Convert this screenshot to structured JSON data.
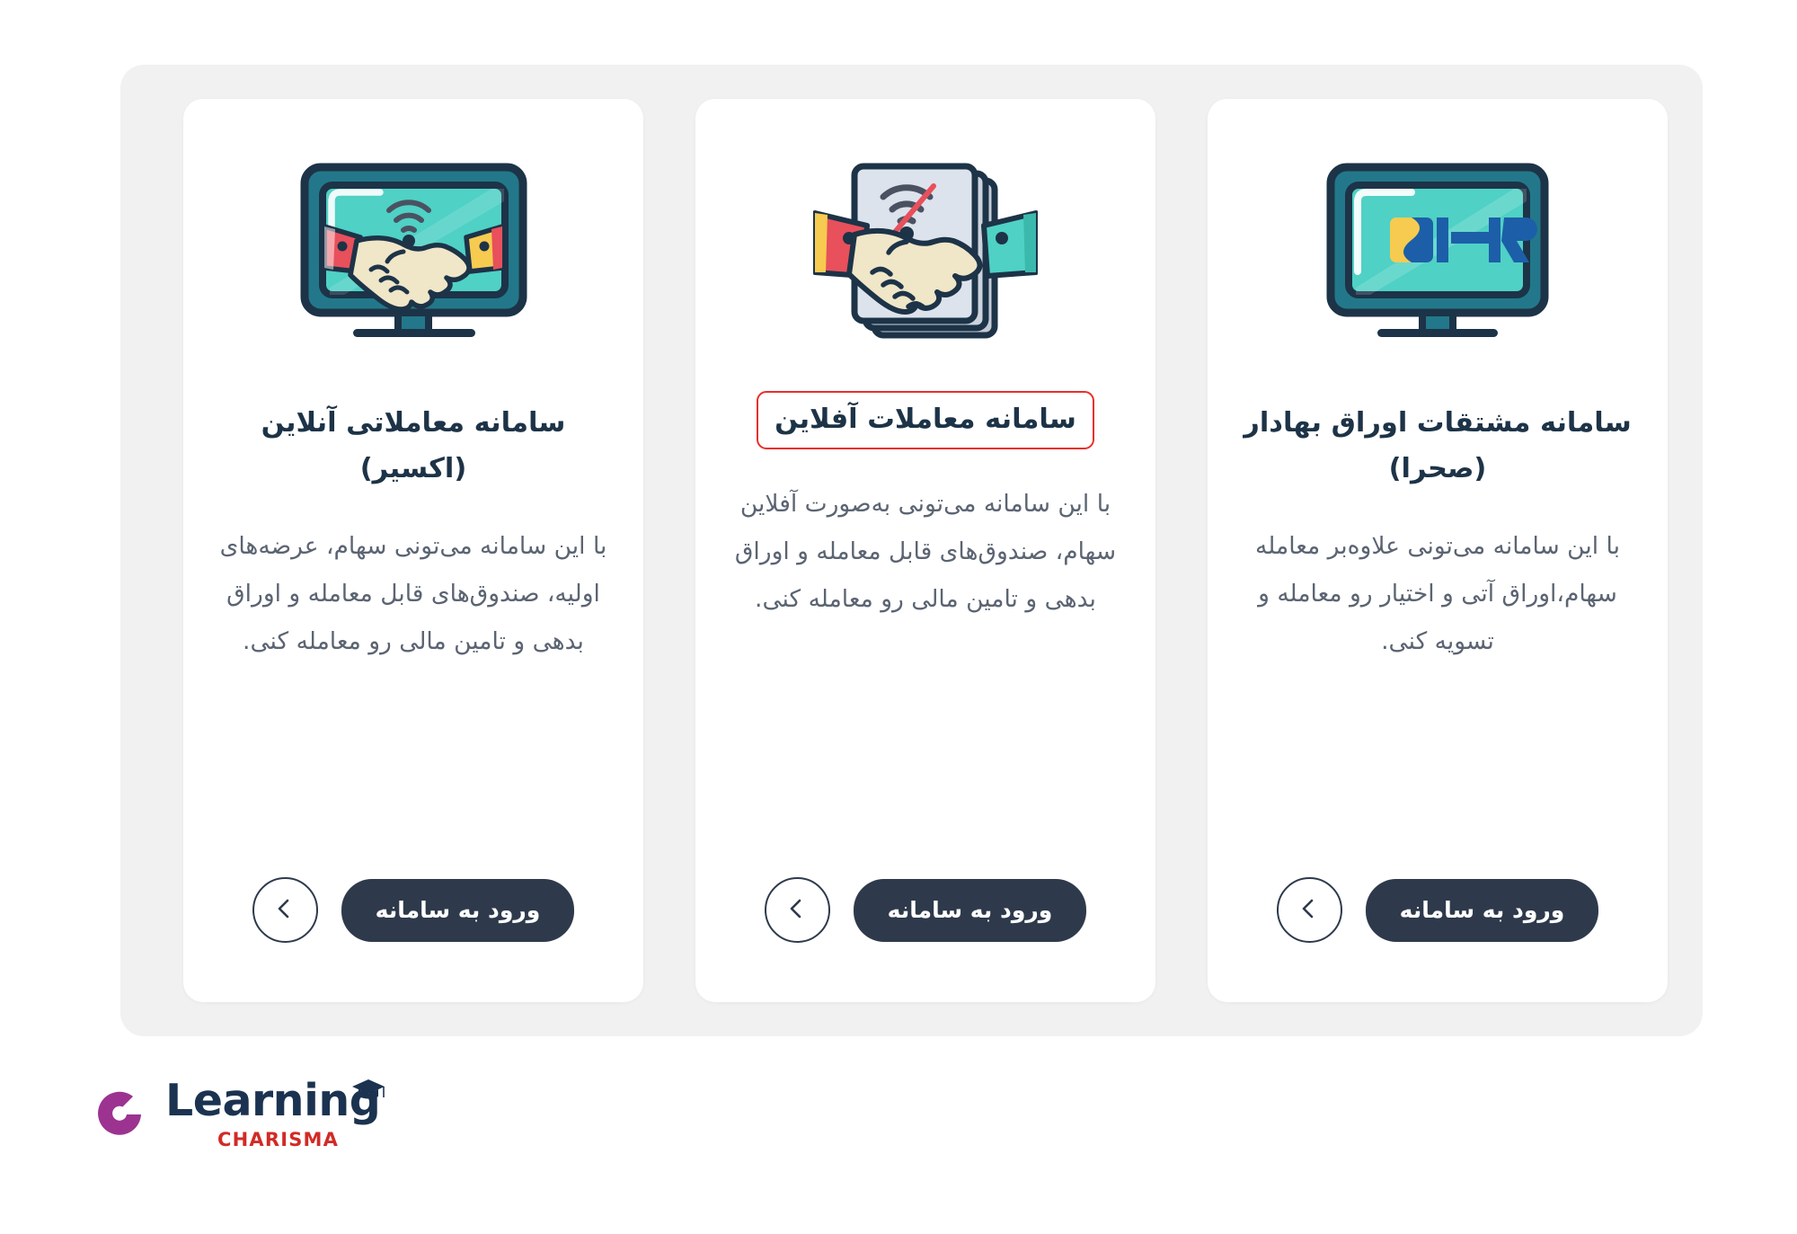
{
  "colors": {
    "page_background": "#ffffff",
    "panel_background": "#f1f1f1",
    "card_background": "#ffffff",
    "title_text": "#1d3347",
    "body_text": "#5b6472",
    "button_background": "#2e3a4c",
    "button_text": "#ffffff",
    "highlight_border": "#e8302c",
    "logo_mark": "#9c3390",
    "logo_word": "#1b3350",
    "logo_sub": "#d12b26",
    "icon_teal": "#4fd1c5",
    "icon_dark": "#1d3347",
    "icon_teal_dark": "#22788a",
    "icon_paper": "#d8dee9",
    "icon_skin": "#f0e6c8",
    "icon_red": "#e8505b",
    "icon_yellow": "#f6cb50"
  },
  "cards": [
    {
      "icon": "monitor-ihr-logo-icon",
      "title": "سامانه مشتقات اوراق بهادار (صحرا)",
      "body": "با این سامانه می‌تونی علاوه‌بر معامله سهام،اوراق آتی و اختیار رو معامله و تسویه کنی.",
      "title_highlighted": false,
      "enter_label": "ورود به سامانه",
      "back_icon": "chevron-left-icon"
    },
    {
      "icon": "offline-handshake-documents-icon",
      "title": "سامانه معاملات آفلاین",
      "body": "با این سامانه می‌تونی به‌صورت آفلاین سهام، صندوق‌های قابل معامله و اوراق بدهی و تامین مالی رو معامله کنی.",
      "title_highlighted": true,
      "enter_label": "ورود به سامانه",
      "back_icon": "chevron-left-icon"
    },
    {
      "icon": "online-handshake-monitor-icon",
      "title": "سامانه معاملاتی آنلاین (اکسیر)",
      "body": "با این سامانه می‌تونی سهام، عرضه‌های اولیه، صندوق‌های قابل معامله و اوراق بدهی و تامین مالی رو معامله کنی.",
      "title_highlighted": false,
      "enter_label": "ورود به سامانه",
      "back_icon": "chevron-left-icon"
    }
  ],
  "logo": {
    "mark": "charisma-c-mark-icon",
    "word": "Learning",
    "cap": "graduation-cap-icon",
    "sub": "CHARISMA"
  }
}
